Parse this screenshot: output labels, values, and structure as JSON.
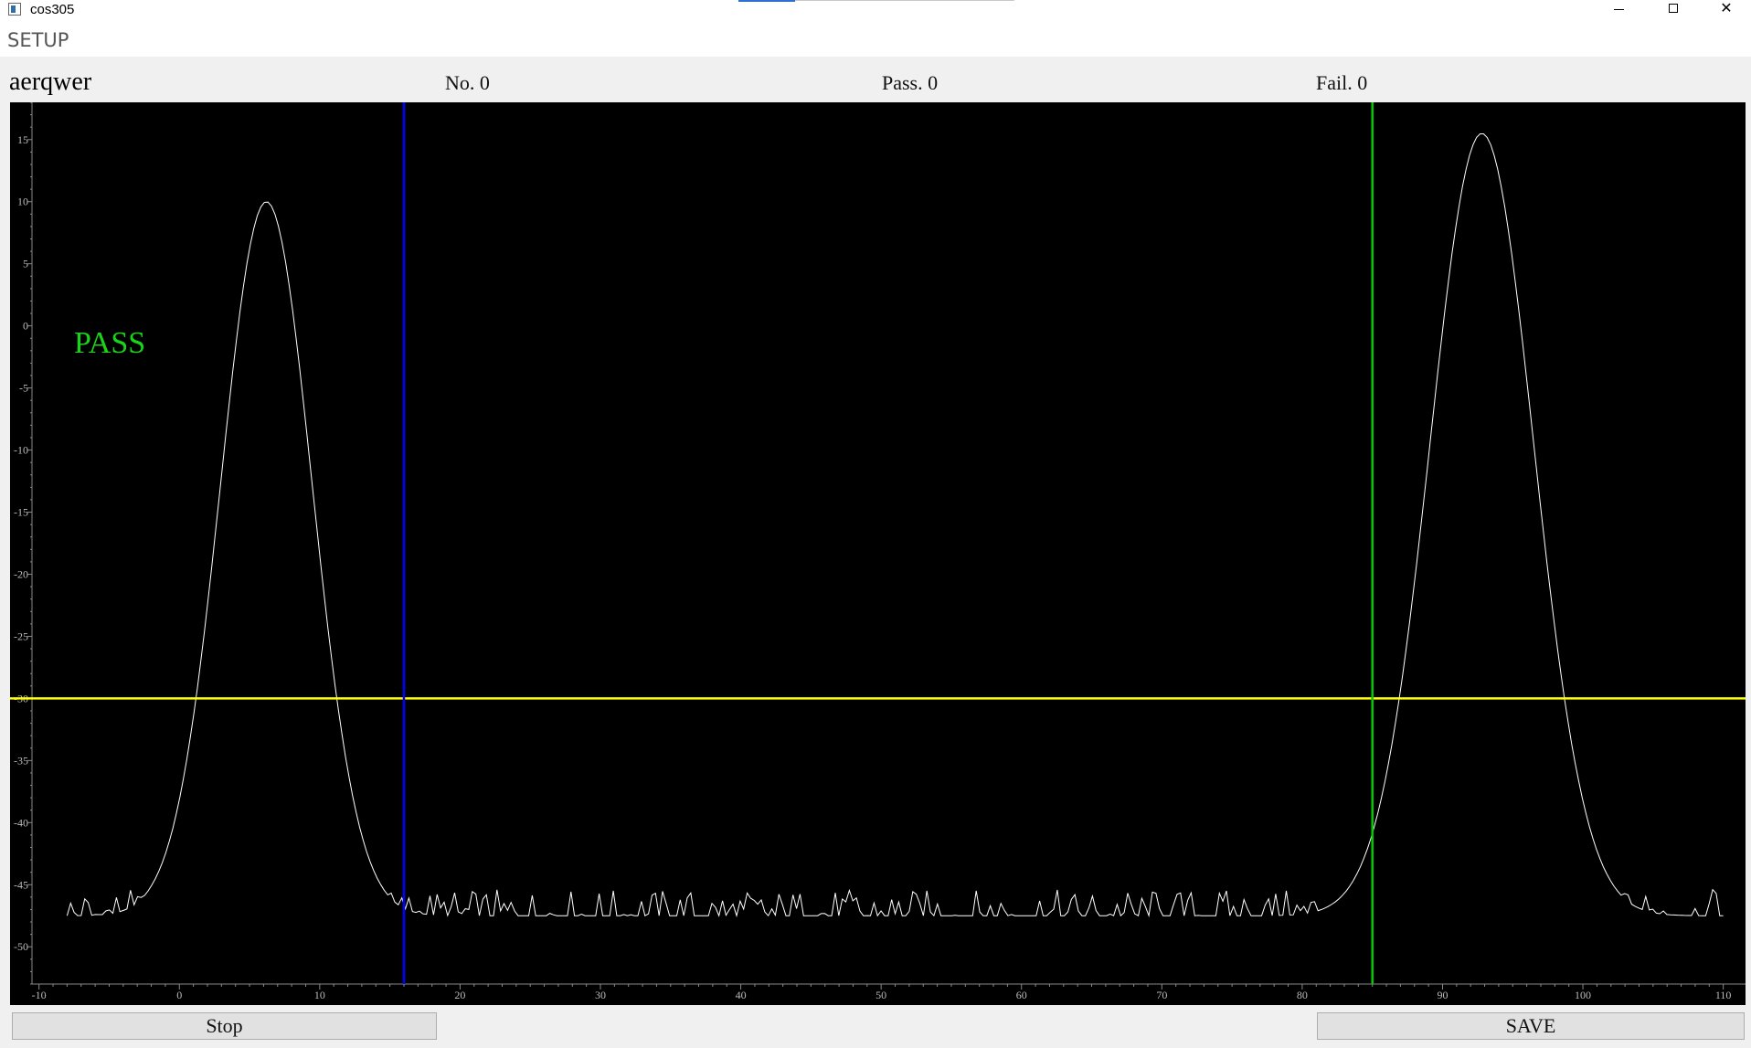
{
  "window": {
    "title": "cos305",
    "controls": [
      "minimize",
      "maximize",
      "close"
    ],
    "close_glyph": "✕"
  },
  "menu": {
    "setup": "SETUP"
  },
  "status": {
    "station": "aerqwer",
    "no": "No. 0",
    "pass": "Pass. 0",
    "fail": "Fail. 0"
  },
  "result": {
    "text": "PASS",
    "color": "#19d419"
  },
  "buttons": {
    "stop": "Stop",
    "save": "SAVE"
  },
  "colors": {
    "plot_bg": "#000000",
    "trace": "#ffffff",
    "threshold": "#ffff00",
    "marker_left": "#0000ff",
    "marker_right": "#00cc00",
    "axis_text": "#bbbbbb"
  },
  "chart_data": {
    "type": "line",
    "xlim": [
      -10.5,
      111
    ],
    "ylim": [
      -53,
      18
    ],
    "x_ticks": [
      -10,
      0,
      10,
      20,
      30,
      40,
      50,
      60,
      70,
      80,
      90,
      100,
      110
    ],
    "y_ticks": [
      15,
      10,
      5,
      0,
      -5,
      -10,
      -15,
      -20,
      -25,
      -30,
      -35,
      -40,
      -45,
      -50
    ],
    "threshold_y": -30,
    "markers": [
      {
        "x": 16,
        "color": "#0000ff"
      },
      {
        "x": 85,
        "color": "#00cc00"
      }
    ],
    "noise_floor": -47.5,
    "peaks": [
      {
        "center": 6.2,
        "peak": 10,
        "width": 4.6
      },
      {
        "center": 92.8,
        "peak": 15.5,
        "width": 5.2
      }
    ],
    "x_start": -8,
    "x_end": 110
  }
}
